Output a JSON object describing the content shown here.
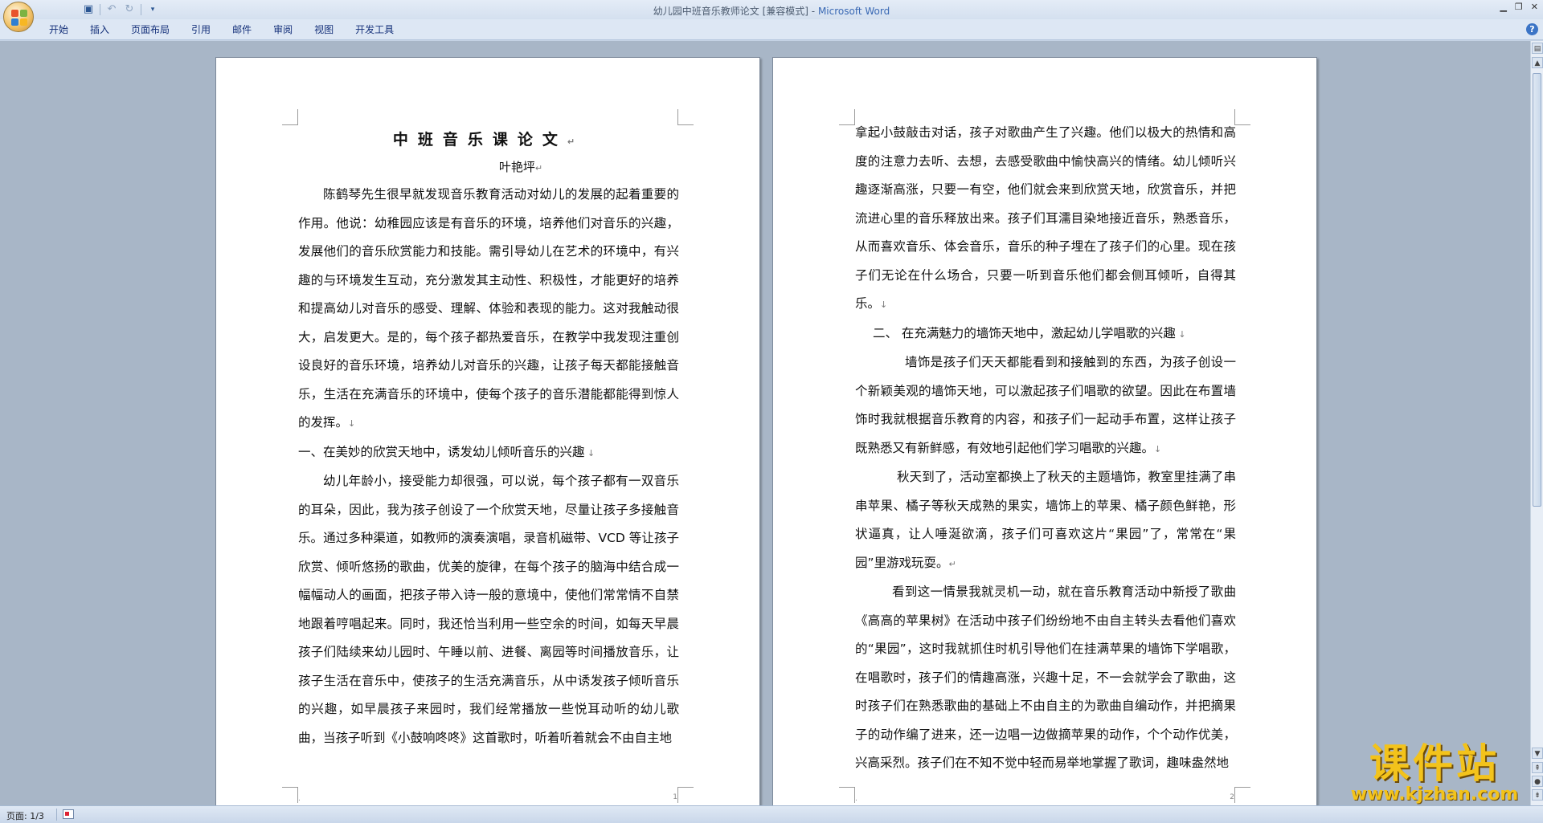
{
  "window": {
    "doc_name": "幼儿园中班音乐教师论文",
    "mode": "[兼容模式]",
    "separator": " - ",
    "app_name": "Microsoft Word"
  },
  "ribbon": {
    "tabs": [
      "开始",
      "插入",
      "页面布局",
      "引用",
      "邮件",
      "审阅",
      "视图",
      "开发工具"
    ]
  },
  "page1": {
    "title": "中班音乐课论文",
    "author": "叶艳坪",
    "intro": "陈鹤琴先生很早就发现音乐教育活动对幼儿的发展的起着重要的作用。他说：幼稚园应该是有音乐的环境，培养他们对音乐的兴趣，发展他们的音乐欣赏能力和技能。需引导幼儿在艺术的环境中，有兴趣的与环境发生互动，充分激发其主动性、积极性，才能更好的培养和提高幼儿对音乐的感受、理解、体验和表现的能力。这对我触动很大，启发更大。是的，每个孩子都热爱音乐，在教学中我发现注重创设良好的音乐环境，培养幼儿对音乐的兴趣，让孩子每天都能接触音乐，生活在充满音乐的环境中，使每个孩子的音乐潜能都能得到惊人的发挥。",
    "heading1": "一、在美妙的欣赏天地中，诱发幼儿倾听音乐的兴趣",
    "body1": "幼儿年龄小，接受能力却很强，可以说，每个孩子都有一双音乐的耳朵，因此，我为孩子创设了一个欣赏天地，尽量让孩子多接触音乐。通过多种渠道，如教师的演奏演唱，录音机磁带、VCD 等让孩子欣赏、倾听悠扬的歌曲，优美的旋律，在每个孩子的脑海中结合成一幅幅动人的画面，把孩子带入诗一般的意境中，使他们常常情不自禁地跟着哼唱起来。同时，我还恰当利用一些空余的时间，如每天早晨孩子们陆续来幼儿园时、午睡以前、进餐、离园等时间播放音乐，让孩子生活在音乐中，使孩子的生活充满音乐，从中诱发孩子倾听音乐的兴趣，如早晨孩子来园时，我们经常播放一些悦耳动听的幼儿歌曲，当孩子听到《小鼓响咚咚》这首歌时，听着听着就会不由自主地",
    "page_number": "1"
  },
  "page2": {
    "cont": "拿起小鼓敲击对话，孩子对歌曲产生了兴趣。他们以极大的热情和高度的注意力去听、去想，去感受歌曲中愉快高兴的情绪。幼儿倾听兴趣逐渐高涨，只要一有空，他们就会来到欣赏天地，欣赏音乐，并把流进心里的音乐释放出来。孩子们耳濡目染地接近音乐，熟悉音乐，从而喜欢音乐、体会音乐，音乐的种子埋在了孩子们的心里。现在孩子们无论在什么场合，只要一听到音乐他们都会侧耳倾听，自得其乐。",
    "heading2": "二、 在充满魅力的墙饰天地中，激起幼儿学唱歌的兴趣",
    "body2": "墙饰是孩子们天天都能看到和接触到的东西，为孩子创设一个新颖美观的墙饰天地，可以激起孩子们唱歌的欲望。因此在布置墙饰时我就根据音乐教育的内容，和孩子们一起动手布置，这样让孩子既熟悉又有新鲜感，有效地引起他们学习唱歌的兴趣。",
    "body3": "秋天到了，活动室都换上了秋天的主题墙饰，教室里挂满了串串苹果、橘子等秋天成熟的果实，墙饰上的苹果、橘子颜色鲜艳，形状逼真，让人唾涎欲滴，孩子们可喜欢这片“果园”了，常常在“果园”里游戏玩耍。",
    "body4": "看到这一情景我就灵机一动，就在音乐教育活动中新授了歌曲《高高的苹果树》在活动中孩子们纷纷地不由自主转头去看他们喜欢的“果园”，这时我就抓住时机引导他们在挂满苹果的墙饰下学唱歌，在唱歌时，孩子们的情趣高涨，兴趣十足，不一会就学会了歌曲，这时孩子们在熟悉歌曲的基础上不由自主的为歌曲自编动作，并把摘果子的动作编了进来，还一边唱一边做摘苹果的动作，个个动作优美，兴高采烈。孩子们在不知不觉中轻而易举地掌握了歌词，趣味盎然地",
    "page_number": "2"
  },
  "status": {
    "page_label": "页面: 1/3"
  },
  "watermark": {
    "main": "课件站",
    "url": "www.kjzhan.com"
  },
  "colors": {
    "app_name": "#3a69b4",
    "workspace": "#a8b6c7",
    "watermark": "#f3c31b"
  }
}
